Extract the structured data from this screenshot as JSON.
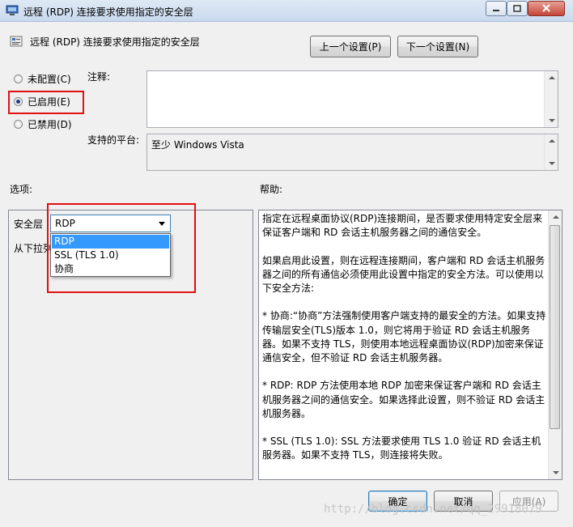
{
  "window": {
    "title": "远程 (RDP) 连接要求使用指定的安全层"
  },
  "header": {
    "policy_title": "远程 (RDP) 连接要求使用指定的安全层",
    "prev_label": "上一个设置(P)",
    "next_label": "下一个设置(N)"
  },
  "state": {
    "not_configured": "未配置(C)",
    "enabled": "已启用(E)",
    "disabled": "已禁用(D)",
    "selected": "enabled"
  },
  "comment": {
    "label": "注释:",
    "value": ""
  },
  "platform": {
    "label": "支持的平台:",
    "value": "至少 Windows Vista"
  },
  "options": {
    "label": "选项:",
    "security_layer_label": "安全层",
    "dropdown_prefix": "从下拉列",
    "selected": "RDP",
    "items": [
      "RDP",
      "SSL (TLS 1.0)",
      "协商"
    ]
  },
  "help": {
    "label": "帮助:",
    "paragraphs": [
      "指定在远程桌面协议(RDP)连接期间，是否要求使用特定安全层来保证客户端和 RD 会话主机服务器之间的通信安全。",
      "如果启用此设置，则在远程连接期间，客户端和 RD 会话主机服务器之间的所有通信必须使用此设置中指定的安全方法。可以使用以下安全方法:",
      "* 协商:“协商”方法强制使用客户端支持的最安全的方法。如果支持传输层安全(TLS)版本 1.0，则它将用于验证 RD 会话主机服务器。如果不支持 TLS，则使用本地远程桌面协议(RDP)加密来保证通信安全，但不验证 RD 会话主机服务器。",
      "* RDP: RDP 方法使用本地 RDP 加密来保证客户端和 RD 会话主机服务器之间的通信安全。如果选择此设置，则不验证 RD 会话主机服务器。",
      "* SSL (TLS 1.0): SSL 方法要求使用 TLS 1.0 验证 RD 会话主机服务器。如果不支持 TLS，则连接将失败。"
    ]
  },
  "footer": {
    "ok_label": "确定",
    "cancel_label": "取消",
    "apply_label": "应用(A)"
  },
  "watermark": "http://blog.csdn.net/qq_29918079",
  "colors": {
    "highlight_red": "#e01010",
    "selection_blue": "#3399ff"
  }
}
